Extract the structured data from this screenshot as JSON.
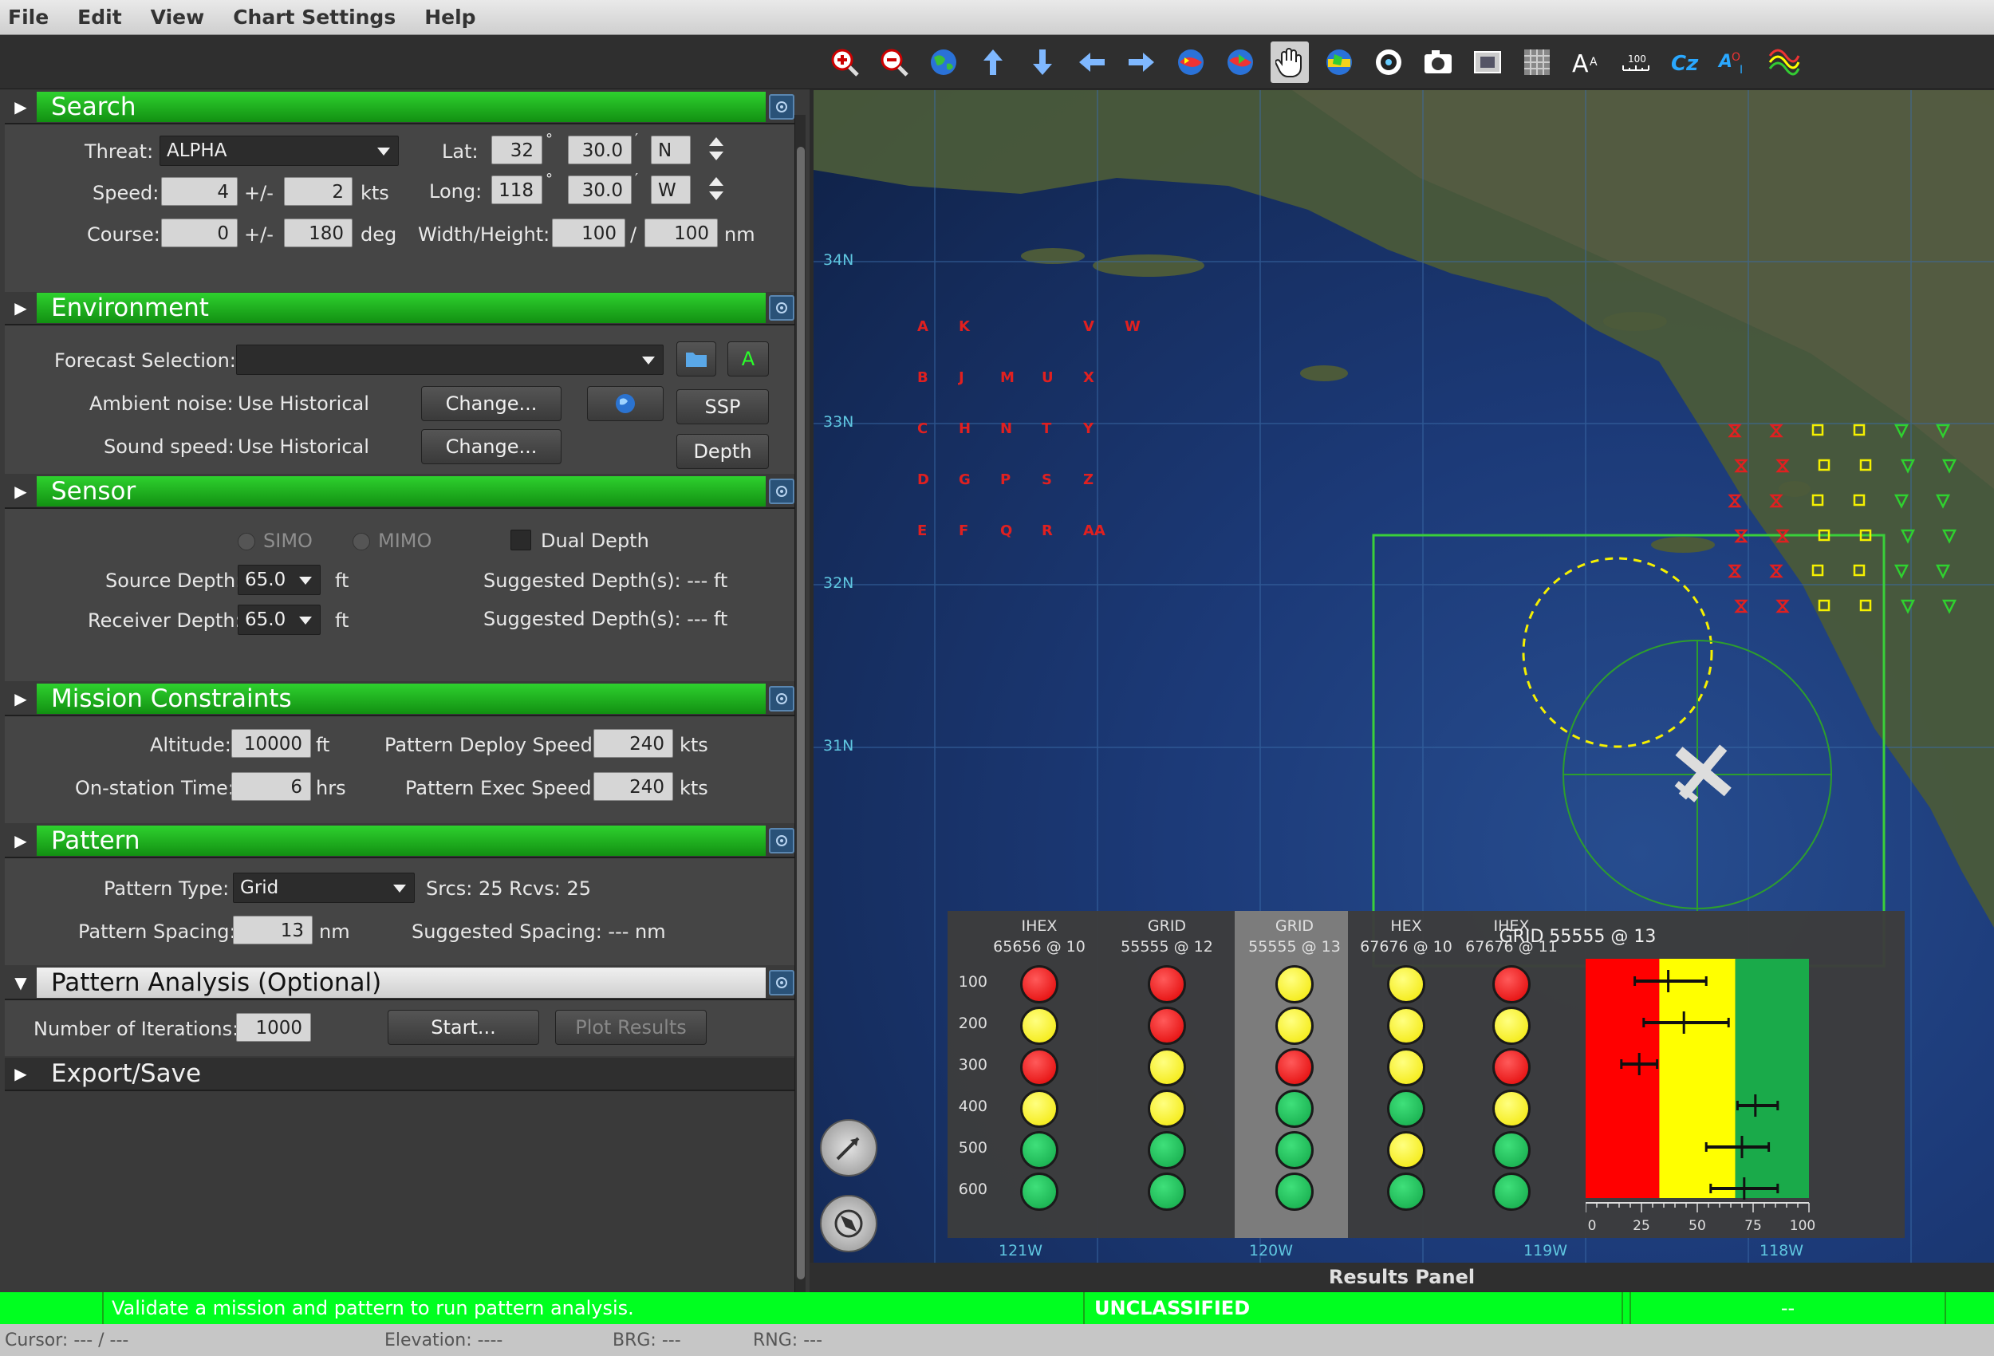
{
  "menu": [
    "File",
    "Edit",
    "View",
    "Chart Settings",
    "Help"
  ],
  "toolbar_icons": [
    "zoom-in-icon",
    "zoom-out-icon",
    "globe-icon",
    "arrow-up-icon",
    "arrow-down-icon",
    "arrow-left-icon",
    "arrow-right-icon",
    "map-layers-icon",
    "map-layers-alt-icon",
    "pan-hand-icon",
    "globe-color-icon",
    "camera-record-icon",
    "camera-icon",
    "screenshot-icon",
    "grid-icon",
    "font-size-icon",
    "scale-100-icon",
    "cz-icon",
    "aoi-icon",
    "bathymetry-icon"
  ],
  "sections": {
    "search": {
      "title": "Search",
      "threat_label": "Threat:",
      "threat_value": "ALPHA",
      "speed_label": "Speed:",
      "speed_value": "4",
      "speed_pm": "+/-",
      "speed_tol": "2",
      "speed_unit": "kts",
      "course_label": "Course:",
      "course_value": "0",
      "course_pm": "+/-",
      "course_tol": "180",
      "course_unit": "deg",
      "lat_label": "Lat:",
      "lat_deg": "32",
      "lat_deg_sym": "°",
      "lat_min": "30.0",
      "lat_min_sym": "′",
      "lat_hemi": "N",
      "lon_label": "Long:",
      "lon_deg": "118",
      "lon_deg_sym": "°",
      "lon_min": "30.0",
      "lon_min_sym": "′",
      "lon_hemi": "W",
      "wh_label": "Width/Height:",
      "width": "100",
      "slash": "/",
      "height": "100",
      "wh_unit": "nm"
    },
    "environment": {
      "title": "Environment",
      "forecast_label": "Forecast Selection:",
      "forecast_value": "",
      "ambient_label": "Ambient noise:",
      "ambient_value": "Use Historical",
      "change1": "Change...",
      "sound_label": "Sound speed:",
      "sound_value": "Use Historical",
      "change2": "Change...",
      "ssp": "SSP",
      "depth": "Depth",
      "a_btn": "A"
    },
    "sensor": {
      "title": "Sensor",
      "simo": "SIMO",
      "mimo": "MIMO",
      "dual_depth": "Dual Depth",
      "source_label": "Source Depth:",
      "source_value": "65.0",
      "source_unit": "ft",
      "receiver_label": "Receiver Depth:",
      "receiver_value": "65.0",
      "receiver_unit": "ft",
      "suggested1": "Suggested Depth(s): --- ft",
      "suggested2": "Suggested Depth(s): --- ft"
    },
    "mission": {
      "title": "Mission Constraints",
      "altitude_label": "Altitude:",
      "altitude_value": "10000",
      "altitude_unit": "ft",
      "onstation_label": "On-station Time:",
      "onstation_value": "6",
      "onstation_unit": "hrs",
      "deploy_label": "Pattern Deploy Speed:",
      "deploy_value": "240",
      "deploy_unit": "kts",
      "exec_label": "Pattern Exec Speed:",
      "exec_value": "240",
      "exec_unit": "kts"
    },
    "pattern": {
      "title": "Pattern",
      "type_label": "Pattern Type:",
      "type_value": "Grid",
      "srcs_rcvs": "Srcs: 25  Rcvs: 25",
      "spacing_label": "Pattern Spacing:",
      "spacing_value": "13",
      "spacing_unit": "nm",
      "suggested_spacing": "Suggested Spacing: --- nm"
    },
    "analysis": {
      "title": "Pattern Analysis (Optional)",
      "iterations_label": "Number of Iterations:",
      "iterations_value": "1000",
      "start": "Start...",
      "plot": "Plot Results"
    },
    "export": {
      "title": "Export/Save"
    }
  },
  "map": {
    "lat_labels": [
      "34N",
      "33N",
      "32N",
      "31N"
    ],
    "lon_labels": [
      "121W",
      "120W",
      "119W",
      "118W"
    ],
    "grid_labels_red": [
      "A",
      "K",
      "V",
      "W",
      "B",
      "J",
      "M",
      "U",
      "X",
      "C",
      "H",
      "N",
      "T",
      "Y",
      "D",
      "G",
      "P",
      "S",
      "Z",
      "E",
      "F",
      "Q",
      "R",
      "AA"
    ]
  },
  "results": {
    "panel_label": "Results Panel",
    "columns": [
      {
        "type": "IHEX",
        "config": "65656 @ 10"
      },
      {
        "type": "GRID",
        "config": "55555 @ 12"
      },
      {
        "type": "GRID",
        "config": "55555 @ 13"
      },
      {
        "type": "HEX",
        "config": "67676 @ 10"
      },
      {
        "type": "IHEX",
        "config": "67676 @ 11"
      }
    ],
    "rows": [
      "100",
      "200",
      "300",
      "400",
      "500",
      "600"
    ],
    "matrix": [
      [
        "red",
        "red",
        "yellow",
        "yellow",
        "red"
      ],
      [
        "yellow",
        "red",
        "yellow",
        "yellow",
        "yellow"
      ],
      [
        "red",
        "yellow",
        "red",
        "yellow",
        "red"
      ],
      [
        "yellow",
        "yellow",
        "green",
        "green",
        "yellow"
      ],
      [
        "green",
        "green",
        "green",
        "yellow",
        "green"
      ],
      [
        "green",
        "green",
        "green",
        "green",
        "green"
      ]
    ],
    "selected_column": 2,
    "chart_title": "GRID 55555 @ 13",
    "chart_ticks": [
      "0",
      "25",
      "50",
      "75",
      "100"
    ],
    "chart_colors": {
      "red": "#ff0000",
      "yellow": "#ffff00",
      "green": "#1aaa4a"
    }
  },
  "chart_data": {
    "type": "scatter",
    "title": "GRID 55555 @ 13",
    "xlabel": "",
    "ylabel": "",
    "xlim": [
      0,
      100
    ],
    "x_ticks": [
      "0",
      "25",
      "50",
      "75",
      "100"
    ],
    "bands": [
      {
        "from": 0,
        "to": 33,
        "color": "#ff0000"
      },
      {
        "from": 33,
        "to": 67,
        "color": "#ffff00"
      },
      {
        "from": 67,
        "to": 100,
        "color": "#1aaa4a"
      }
    ],
    "points": [
      {
        "row": "100",
        "x": 37,
        "err": [
          22,
          54
        ]
      },
      {
        "row": "200",
        "x": 44,
        "err": [
          26,
          64
        ]
      },
      {
        "row": "300",
        "x": 24,
        "err": [
          16,
          32
        ]
      },
      {
        "row": "400",
        "x": 76,
        "err": [
          68,
          86
        ]
      },
      {
        "row": "500",
        "x": 70,
        "err": [
          54,
          82
        ]
      },
      {
        "row": "600",
        "x": 71,
        "err": [
          56,
          86
        ]
      }
    ]
  },
  "status": {
    "message": "Validate a mission and pattern to run pattern analysis.",
    "classification": "UNCLASSIFIED",
    "right": "--"
  },
  "coords": {
    "cursor": "Cursor:  ---  /  ---",
    "elevation": "Elevation:  ----",
    "brg": "BRG:  ---",
    "rng": "RNG:  ---"
  }
}
